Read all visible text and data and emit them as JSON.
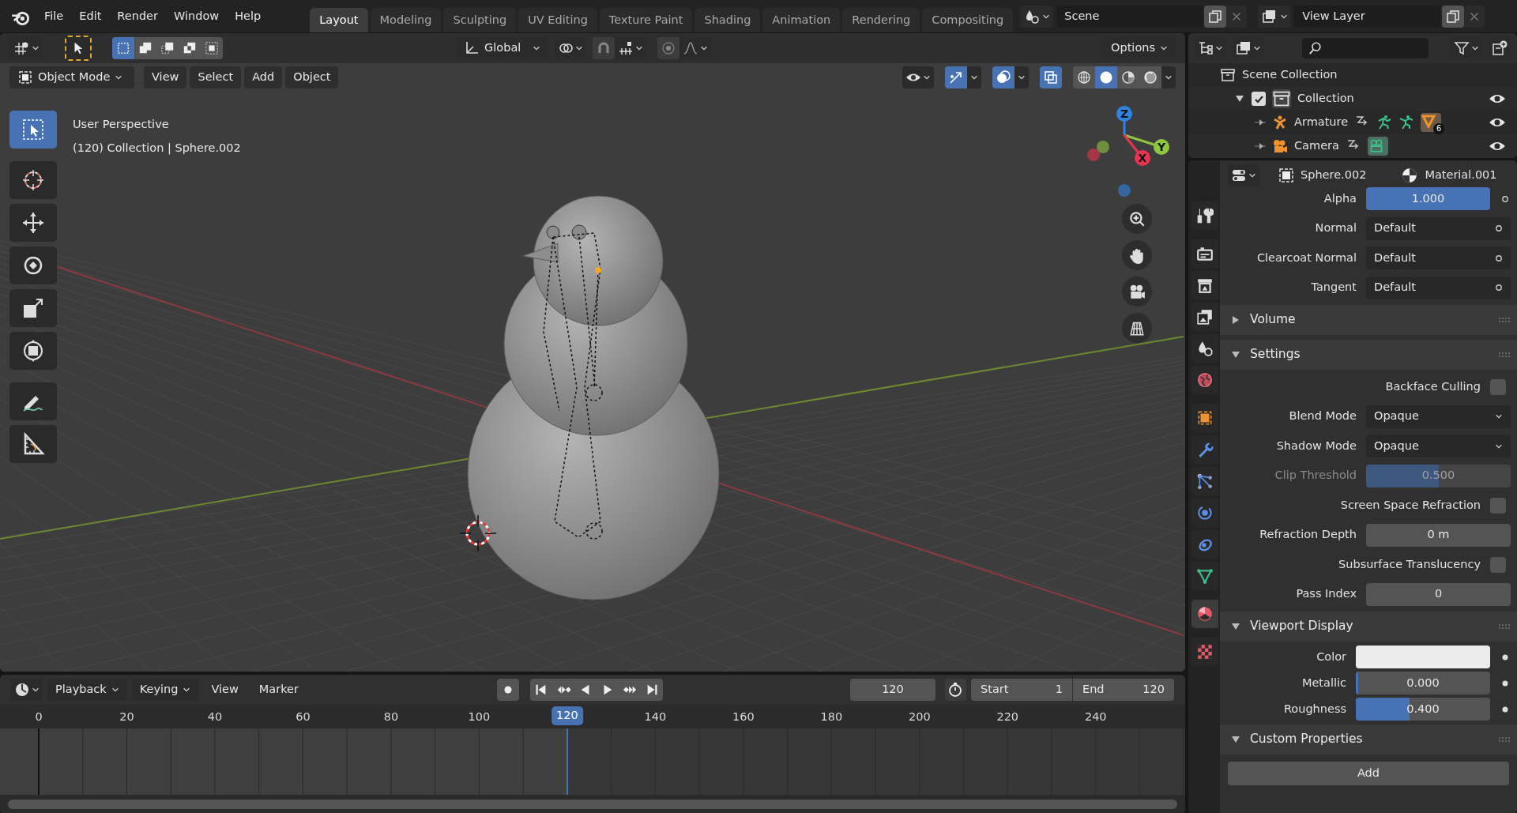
{
  "menu": [
    "File",
    "Edit",
    "Render",
    "Window",
    "Help"
  ],
  "workspaces": [
    {
      "label": "Layout",
      "selected": true
    },
    {
      "label": "Modeling",
      "selected": false
    },
    {
      "label": "Sculpting",
      "selected": false
    },
    {
      "label": "UV Editing",
      "selected": false
    },
    {
      "label": "Texture Paint",
      "selected": false
    },
    {
      "label": "Shading",
      "selected": false
    },
    {
      "label": "Animation",
      "selected": false
    },
    {
      "label": "Rendering",
      "selected": false
    },
    {
      "label": "Compositing",
      "selected": false
    }
  ],
  "scene": "Scene",
  "view_layer": "View Layer",
  "tool_header": {
    "select_modes": [
      {
        "selected": true
      },
      {
        "selected": false
      },
      {
        "selected": false
      },
      {
        "selected": false
      },
      {
        "selected": false
      }
    ],
    "orientation": "Global",
    "options": "Options"
  },
  "view_header": {
    "mode": "Object Mode",
    "menus": [
      "View",
      "Select",
      "Add",
      "Object"
    ],
    "shading": [
      {
        "kind": "wireframe",
        "selected": false
      },
      {
        "kind": "solid",
        "selected": true
      },
      {
        "kind": "material",
        "selected": false
      },
      {
        "kind": "rendered",
        "selected": false
      }
    ]
  },
  "viewport": {
    "info": [
      "User Perspective",
      "(120) Collection | Sphere.002"
    ],
    "tools": [
      {
        "kind": "select-box",
        "selected": true
      },
      {
        "kind": "cursor",
        "selected": false
      },
      {
        "kind": "move",
        "selected": false
      },
      {
        "kind": "rotate",
        "selected": false
      },
      {
        "kind": "scale",
        "selected": false
      },
      {
        "kind": "transform",
        "selected": false
      },
      {
        "kind": "annotate",
        "selected": false
      },
      {
        "kind": "measure",
        "selected": false
      }
    ],
    "axes": [
      {
        "label": "Z",
        "color": "#2f83e3"
      },
      {
        "label": "Y",
        "color": "#8ec63f"
      },
      {
        "label": "X",
        "color": "#e8344e"
      }
    ]
  },
  "timeline": {
    "menus": [
      "Playback",
      "Keying",
      "View",
      "Marker"
    ],
    "current_frame": "120",
    "start_label": "Start",
    "start": "1",
    "end_label": "End",
    "end": "120",
    "ticks": [
      "0",
      "20",
      "40",
      "60",
      "80",
      "100",
      "140",
      "160",
      "180",
      "200",
      "220",
      "240"
    ],
    "playhead": "120"
  },
  "outliner": {
    "items": [
      {
        "label": "Scene Collection",
        "kind": "collection",
        "children": [
          {
            "label": "Collection",
            "kind": "collection",
            "checked": true,
            "expanded": true,
            "visible": true,
            "children": [
              {
                "label": "Armature",
                "kind": "armature",
                "badge": "6",
                "visible": true
              },
              {
                "label": "Camera",
                "kind": "camera",
                "visible": true
              }
            ]
          }
        ]
      }
    ]
  },
  "properties": {
    "object": "Sphere.002",
    "material": "Material.001",
    "tabs": [
      {
        "kind": "tool",
        "selected": false
      },
      {
        "kind": "render",
        "selected": false
      },
      {
        "kind": "output",
        "selected": false
      },
      {
        "kind": "view-layer",
        "selected": false
      },
      {
        "kind": "scene",
        "selected": false
      },
      {
        "kind": "world",
        "selected": false
      },
      {
        "kind": "object",
        "selected": false
      },
      {
        "kind": "modifier",
        "selected": false
      },
      {
        "kind": "particles",
        "selected": false
      },
      {
        "kind": "physics",
        "selected": false
      },
      {
        "kind": "constraints",
        "selected": false
      },
      {
        "kind": "data",
        "selected": false
      },
      {
        "kind": "material",
        "selected": true
      },
      {
        "kind": "texture",
        "selected": false
      }
    ],
    "rows": [
      {
        "kind": "slider",
        "label": "Alpha",
        "value": "1.000",
        "level": 1,
        "disabled": false
      },
      {
        "kind": "socket",
        "label": "Normal",
        "value": "Default",
        "disabled": false
      },
      {
        "kind": "socket",
        "label": "Clearcoat Normal",
        "value": "Default",
        "disabled": false
      },
      {
        "kind": "socket",
        "label": "Tangent",
        "value": "Default",
        "disabled": false
      },
      {
        "kind": "panel",
        "label": "Volume",
        "expanded": false
      },
      {
        "kind": "panel",
        "label": "Settings",
        "expanded": true
      },
      {
        "kind": "checkbox",
        "label": "Backface Culling",
        "checked": false,
        "disabled": false
      },
      {
        "kind": "dropdown",
        "label": "Blend Mode",
        "value": "Opaque",
        "disabled": false
      },
      {
        "kind": "dropdown",
        "label": "Shadow Mode",
        "value": "Opaque",
        "disabled": false
      },
      {
        "kind": "slider",
        "label": "Clip Threshold",
        "value": "0.500",
        "level": 0.5,
        "disabled": true
      },
      {
        "kind": "checkbox",
        "label": "Screen Space Refraction",
        "checked": false,
        "disabled": false
      },
      {
        "kind": "number",
        "label": "Refraction Depth",
        "value": "0 m",
        "disabled": false
      },
      {
        "kind": "checkbox",
        "label": "Subsurface Translucency",
        "checked": false,
        "disabled": false
      },
      {
        "kind": "number",
        "label": "Pass Index",
        "value": "0",
        "disabled": false
      },
      {
        "kind": "panel",
        "label": "Viewport Display",
        "expanded": true
      },
      {
        "kind": "color",
        "label": "Color",
        "color": "#ececec",
        "disabled": false
      },
      {
        "kind": "slider",
        "label": "Metallic",
        "value": "0.000",
        "level": 0,
        "disabled": false
      },
      {
        "kind": "slider",
        "label": "Roughness",
        "value": "0.400",
        "level": 0.4,
        "disabled": false
      },
      {
        "kind": "panel",
        "label": "Custom Properties",
        "expanded": true
      },
      {
        "kind": "button",
        "label": "Add"
      }
    ]
  }
}
